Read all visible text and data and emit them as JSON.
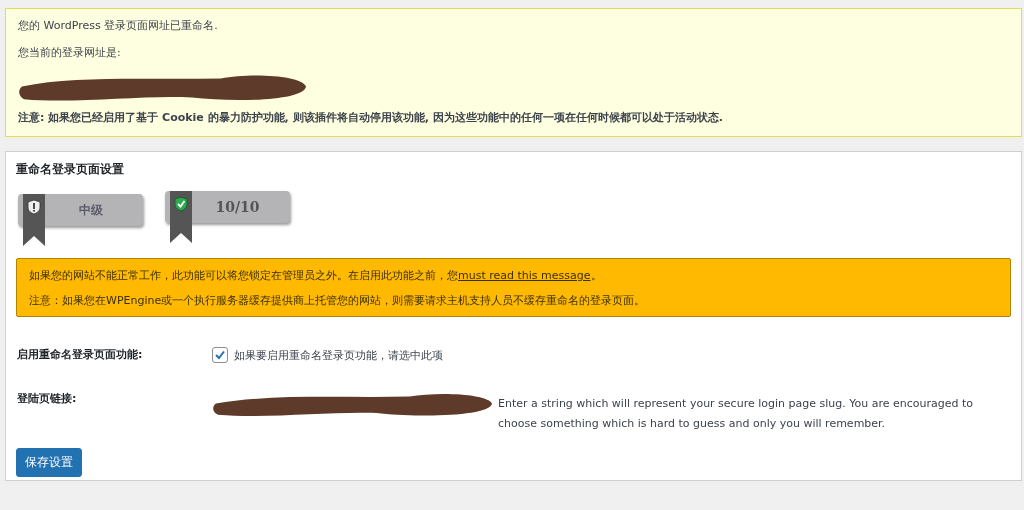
{
  "notice": {
    "lines": [
      "您的 WordPress 登录页面网址已重命名.",
      "您当前的登录网址是:"
    ],
    "note": "注意: 如果您已经启用了基于 Cookie 的暴力防护功能, 则该插件将自动停用该功能, 因为这些功能中的任何一项在任何时候都可以处于活动状态."
  },
  "settings": {
    "title": "重命名登录页面设置",
    "badges": [
      {
        "kind": "shield-alert",
        "label": "中级"
      },
      {
        "kind": "shield-check",
        "label": "10/10"
      }
    ],
    "warning": {
      "text_before": "如果您的网站不能正常工作，此功能可以将您锁定在管理员之外。在启用此功能之前，您",
      "link": "must read this message",
      "text_after": "。",
      "note": "注意：如果您在WPEngine或一个执行服务器缓存提供商上托管您的网站，则需要请求主机支持人员不缓存重命名的登录页面。"
    },
    "enable_row": {
      "label": "启用重命名登录页面功能:",
      "checked": true,
      "checkbox_label": "如果要启用重命名登录页功能，请选中此项"
    },
    "slug_row": {
      "label": "登陆页链接:",
      "description": "Enter a string which will represent your secure login page slug. You are encouraged to choose something which is hard to guess and only you will remember."
    },
    "save_button": "保存设置"
  }
}
